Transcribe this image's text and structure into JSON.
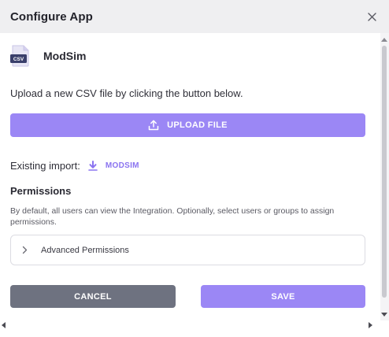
{
  "dialog": {
    "title": "Configure App",
    "close_icon": "close-icon"
  },
  "app": {
    "name": "ModSim",
    "icon": "csv-file-icon",
    "icon_badge": "CSV"
  },
  "instructions": "Upload a new CSV file by clicking the button below.",
  "upload_button": {
    "label": "UPLOAD FILE",
    "icon": "upload-icon"
  },
  "existing_import": {
    "label": "Existing import:",
    "icon": "download-icon",
    "link": "MODSIM"
  },
  "permissions": {
    "heading": "Permissions",
    "description": "By default, all users can view the Integration. Optionally, select users or groups to assign permissions.",
    "advanced_label": "Advanced Permissions",
    "advanced_icon": "chevron-right-icon"
  },
  "footer": {
    "cancel_label": "CANCEL",
    "save_label": "SAVE"
  },
  "colors": {
    "accent": "#9b87f5",
    "accent_text": "#8a73f0",
    "cancel_bg": "#6e7280",
    "header_bg": "#efeff1"
  }
}
